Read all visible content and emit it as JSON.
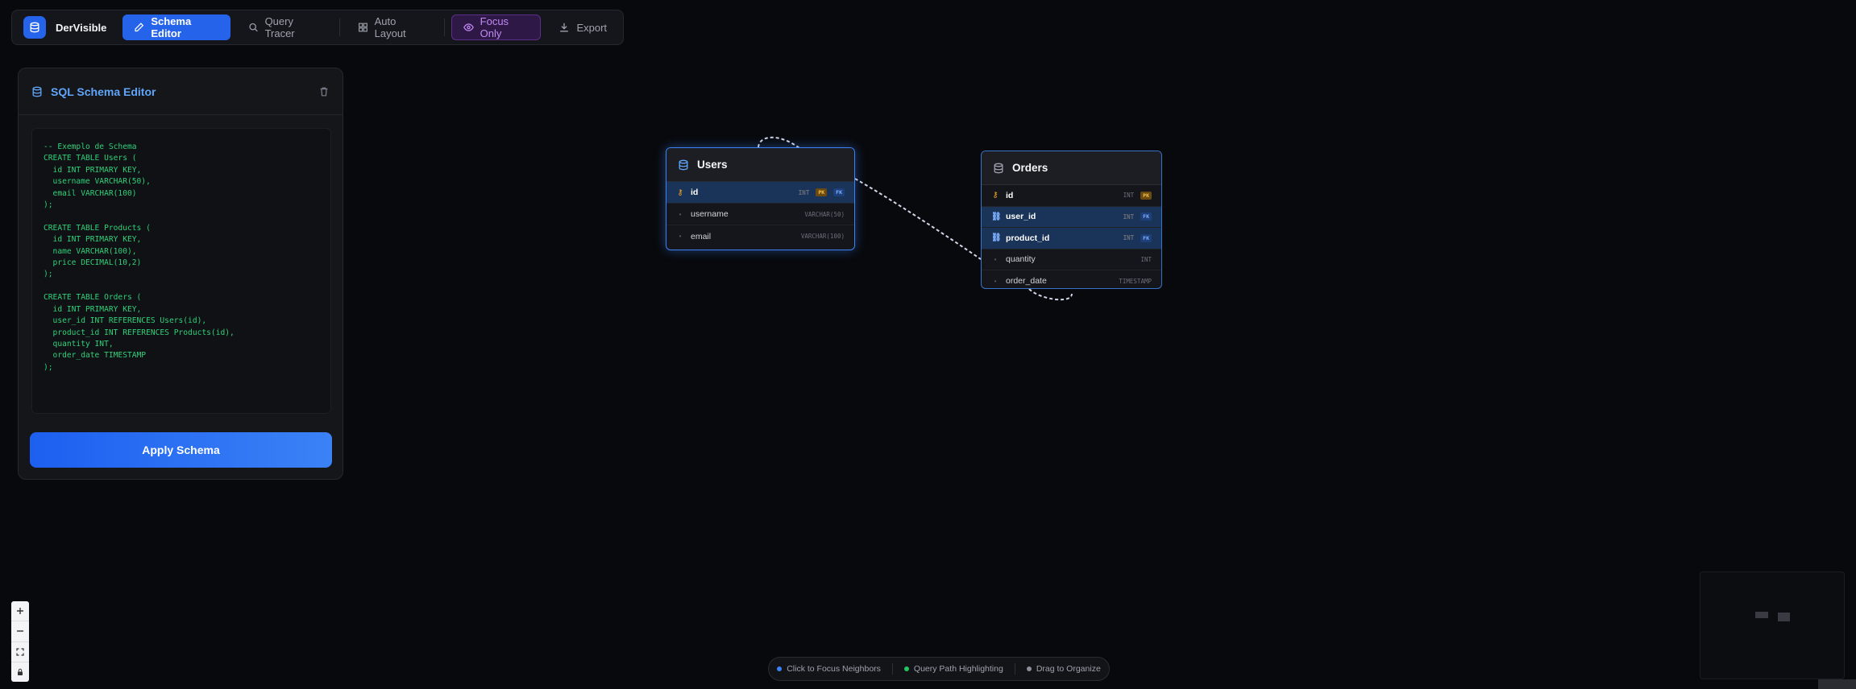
{
  "app": {
    "name": "DerVisible"
  },
  "toolbar": {
    "schema_editor": "Schema Editor",
    "query_tracer": "Query Tracer",
    "auto_layout": "Auto Layout",
    "focus_only": "Focus Only",
    "export": "Export"
  },
  "editor": {
    "title": "SQL Schema Editor",
    "code": "-- Exemplo de Schema\nCREATE TABLE Users (\n  id INT PRIMARY KEY,\n  username VARCHAR(50),\n  email VARCHAR(100)\n);\n\nCREATE TABLE Products (\n  id INT PRIMARY KEY,\n  name VARCHAR(100),\n  price DECIMAL(10,2)\n);\n\nCREATE TABLE Orders (\n  id INT PRIMARY KEY,\n  user_id INT REFERENCES Users(id),\n  product_id INT REFERENCES Products(id),\n  quantity INT,\n  order_date TIMESTAMP\n);",
    "apply_label": "Apply Schema"
  },
  "tables": {
    "users": {
      "name": "Users",
      "columns": [
        {
          "name": "id",
          "type": "INT",
          "pk": "PK",
          "fk": "FK"
        },
        {
          "name": "username",
          "type": "VARCHAR(50)"
        },
        {
          "name": "email",
          "type": "VARCHAR(100)"
        }
      ]
    },
    "orders": {
      "name": "Orders",
      "columns": [
        {
          "name": "id",
          "type": "INT",
          "pk": "PK"
        },
        {
          "name": "user_id",
          "type": "INT",
          "fk": "FK"
        },
        {
          "name": "product_id",
          "type": "INT",
          "fk": "FK"
        },
        {
          "name": "quantity",
          "type": "INT"
        },
        {
          "name": "order_date",
          "type": "TIMESTAMP"
        }
      ]
    }
  },
  "legend": {
    "focus": "Click to Focus Neighbors",
    "query": "Query Path Highlighting",
    "drag": "Drag to Organize"
  },
  "colors": {
    "accent": "#2563eb",
    "focus_purple": "#c38bf5",
    "code_green": "#2fd17a",
    "pk_amber": "#f5c04b",
    "fk_blue": "#7fb1ff"
  }
}
